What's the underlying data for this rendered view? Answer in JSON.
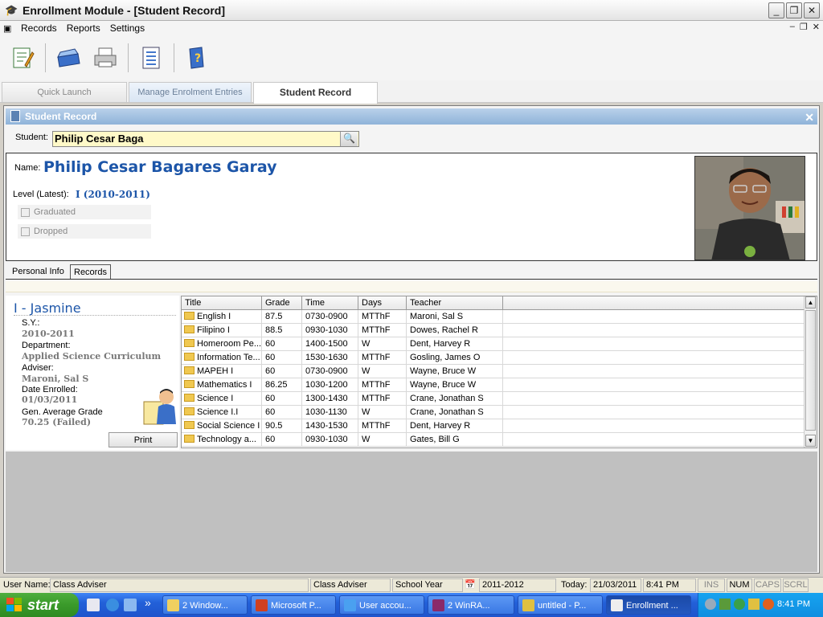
{
  "window": {
    "title": "Enrollment Module - [Student Record]"
  },
  "menu": {
    "items": [
      "Records",
      "Reports",
      "Settings"
    ]
  },
  "toolbar": {
    "buttons": [
      "edit-icon",
      "scanner-icon",
      "printer-icon",
      "list-icon",
      "help-book-icon"
    ]
  },
  "tabs": {
    "quick_launch": "Quick Launch",
    "manage": "Manage Enrolment Entries",
    "student_record": "Student Record"
  },
  "panel": {
    "title": "Student Record"
  },
  "student": {
    "label": "Student:",
    "value": "Philip Cesar Baga"
  },
  "info": {
    "name_label": "Name:",
    "name": "Philip Cesar Bagares Garay",
    "level_label": "Level (Latest):",
    "level": "I (2010-2011)",
    "graduated": "Graduated",
    "dropped": "Dropped"
  },
  "subtabs": {
    "personal": "Personal Info",
    "records": "Records"
  },
  "card": {
    "class_name": "I - Jasmine",
    "sy_label": "S.Y.:",
    "sy": "2010-2011",
    "dept_label": "Department:",
    "dept": "Applied Science Curriculum",
    "adviser_label": "Adviser:",
    "adviser": "Maroni, Sal S",
    "enrolled_label": "Date Enrolled:",
    "enrolled": "01/03/2011",
    "gen_label": "Gen. Average Grade",
    "gen": "70.25 (Failed)",
    "print": "Print"
  },
  "grid": {
    "headers": [
      "Title",
      "Grade",
      "Time",
      "Days",
      "Teacher"
    ],
    "rows": [
      [
        "English I",
        "87.5",
        "0730-0900",
        "MTThF",
        "Maroni, Sal S"
      ],
      [
        "Filipino I",
        "88.5",
        "0930-1030",
        "MTThF",
        "Dowes, Rachel R"
      ],
      [
        "Homeroom Pe...",
        "60",
        "1400-1500",
        "W",
        "Dent, Harvey R"
      ],
      [
        "Information Te...",
        "60",
        "1530-1630",
        "MTThF",
        "Gosling, James O"
      ],
      [
        "MAPEH I",
        "60",
        "0730-0900",
        "W",
        "Wayne, Bruce W"
      ],
      [
        "Mathematics I",
        "86.25",
        "1030-1200",
        "MTThF",
        "Wayne, Bruce W"
      ],
      [
        "Science I",
        "60",
        "1300-1430",
        "MTThF",
        "Crane, Jonathan S"
      ],
      [
        "Science I.I",
        "60",
        "1030-1130",
        "W",
        "Crane, Jonathan S"
      ],
      [
        "Social Science I",
        "90.5",
        "1430-1530",
        "MTThF",
        "Dent, Harvey R"
      ],
      [
        "Technology a...",
        "60",
        "0930-1030",
        "W",
        "Gates, Bill G"
      ]
    ]
  },
  "status": {
    "user_label": "User Name:",
    "user": "Class Adviser",
    "role": "Class Adviser",
    "sy_label": "School Year",
    "sy": "2011-2012",
    "today_label": "Today:",
    "today": "21/03/2011",
    "time": "8:41 PM",
    "ins": "INS",
    "num": "NUM",
    "caps": "CAPS",
    "scrl": "SCRL"
  },
  "taskbar": {
    "start": "start",
    "more": "»",
    "buttons": [
      "2 Window...",
      "Microsoft P...",
      "User accou...",
      "2 WinRA...",
      "untitled - P...",
      "Enrollment ..."
    ],
    "clock": "8:41 PM"
  }
}
